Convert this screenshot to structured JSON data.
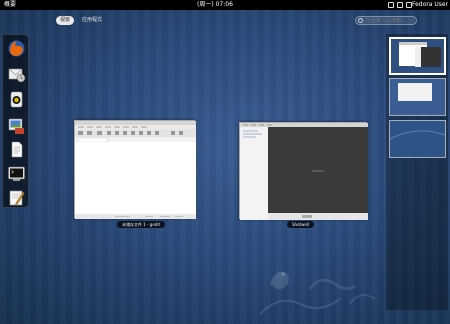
{
  "topbar": {
    "activities": "概要",
    "clock": "(周一) 07:06",
    "user": "Fedora User"
  },
  "view_tabs": [
    {
      "label": "视窗",
      "active": true
    },
    {
      "label": "应用程式",
      "active": false
    }
  ],
  "search": {
    "placeholder": "在此键入以搜索..."
  },
  "windows": [
    {
      "label": "未储存文件 1 - gedit"
    },
    {
      "label": "Shotwell"
    }
  ],
  "dash": [
    "firefox-icon",
    "mail-icon",
    "chat-icon",
    "photo-icon",
    "document-icon",
    "terminal-icon",
    "text-editor-icon"
  ]
}
